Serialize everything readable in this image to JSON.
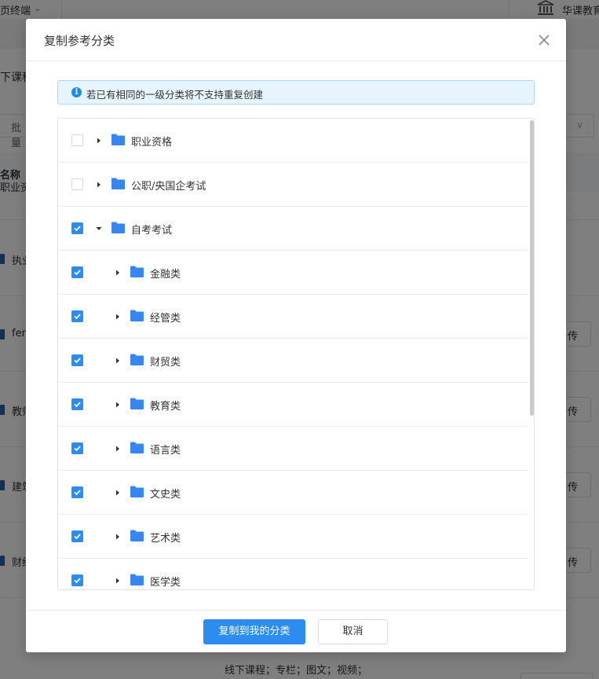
{
  "background": {
    "terminal_label": "页终端",
    "org_name": "华课教育",
    "course_tab": "下课程",
    "batch_label": "批量",
    "column_name": "名称",
    "rows": [
      {
        "text": "职业资",
        "has_book": false,
        "button": ""
      },
      {
        "text": "执业",
        "has_book": true,
        "button": ""
      },
      {
        "text": "fen",
        "has_book": true,
        "button": "传"
      },
      {
        "text": "教师",
        "has_book": true,
        "button": "传"
      },
      {
        "text": "建筑",
        "has_book": true,
        "button": "传"
      },
      {
        "text": "财经",
        "has_book": true,
        "button": "传"
      }
    ],
    "bottom_text": "线下课程；专栏；图文；视频；"
  },
  "dialog": {
    "title": "复制参考分类",
    "notice": "若已有相同的一级分类将不支持重复创建",
    "tree": [
      {
        "label": "职业资格",
        "level": 0,
        "checked": false,
        "expanded": false
      },
      {
        "label": "公职/央国企考试",
        "level": 0,
        "checked": false,
        "expanded": false
      },
      {
        "label": "自考考试",
        "level": 0,
        "checked": true,
        "expanded": true
      },
      {
        "label": "金融类",
        "level": 1,
        "checked": true,
        "expanded": false
      },
      {
        "label": "经管类",
        "level": 1,
        "checked": true,
        "expanded": false
      },
      {
        "label": "财贸类",
        "level": 1,
        "checked": true,
        "expanded": false
      },
      {
        "label": "教育类",
        "level": 1,
        "checked": true,
        "expanded": false
      },
      {
        "label": "语言类",
        "level": 1,
        "checked": true,
        "expanded": false
      },
      {
        "label": "文史类",
        "level": 1,
        "checked": true,
        "expanded": false
      },
      {
        "label": "艺术类",
        "level": 1,
        "checked": true,
        "expanded": false
      },
      {
        "label": "医学类",
        "level": 1,
        "checked": true,
        "expanded": false
      }
    ],
    "confirm_label": "复制到我的分类",
    "cancel_label": "取消"
  },
  "colors": {
    "primary": "#2d8cf0",
    "folder": "#3a86f0",
    "notice_bg": "#e6f4fd",
    "notice_border": "#a8d8f5",
    "info_icon": "#1c8ee6"
  }
}
